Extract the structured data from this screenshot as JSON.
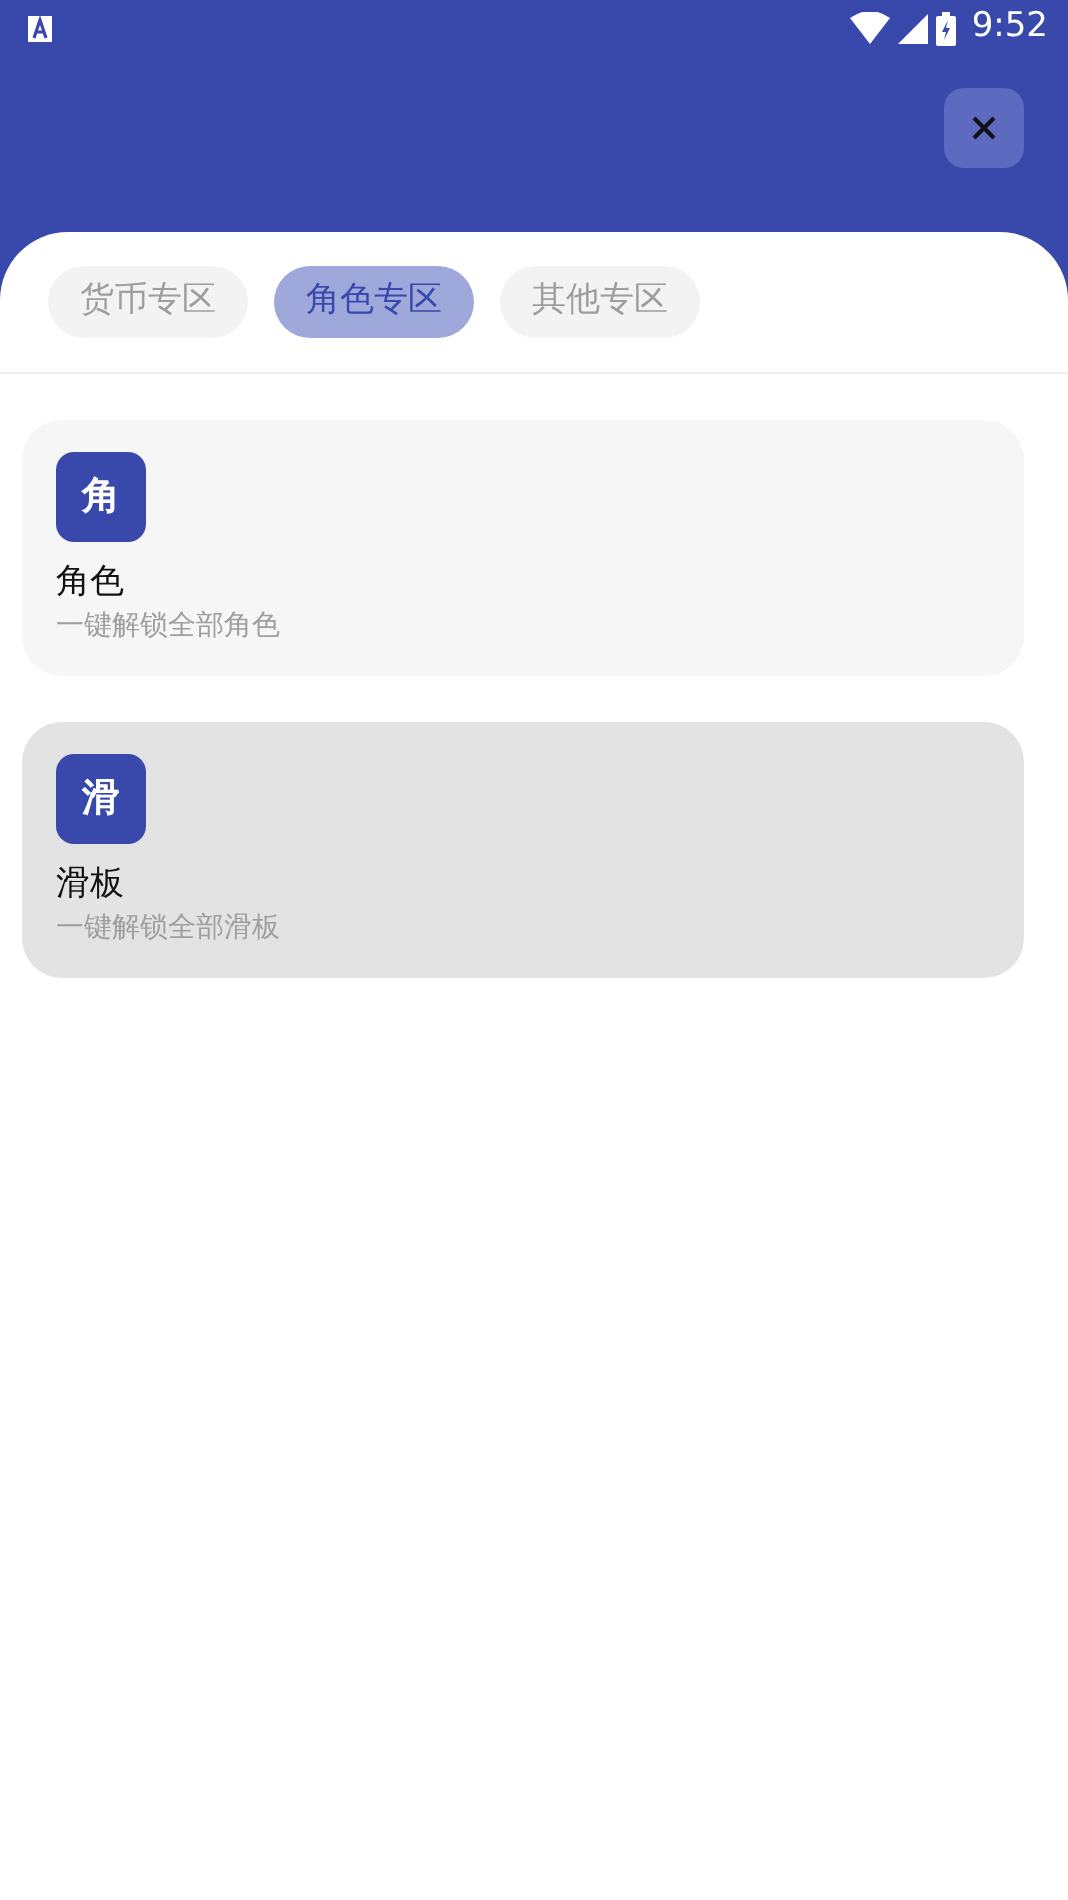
{
  "status_bar": {
    "time": "9:52"
  },
  "tabs": [
    {
      "label": "货币专区",
      "selected": false
    },
    {
      "label": "角色专区",
      "selected": true
    },
    {
      "label": "其他专区",
      "selected": false
    }
  ],
  "items": [
    {
      "icon_text": "角",
      "title": "角色",
      "subtitle": "一键解锁全部角色",
      "highlighted": false
    },
    {
      "icon_text": "滑",
      "title": "滑板",
      "subtitle": "一键解锁全部滑板",
      "highlighted": true
    }
  ]
}
